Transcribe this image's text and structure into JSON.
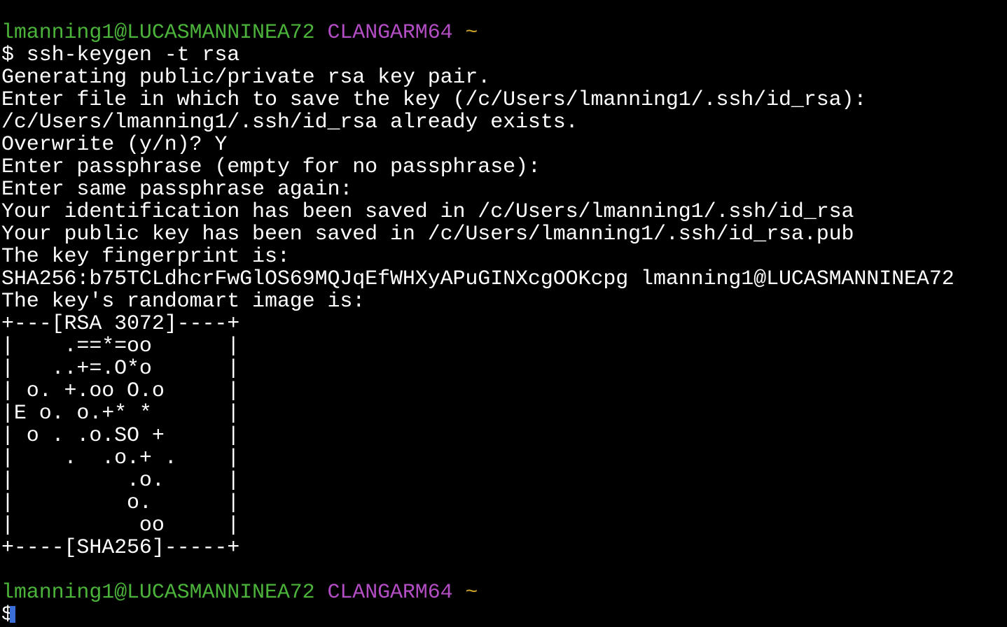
{
  "prompt_top": {
    "user": "lmanning1@LUCASMANNINEA72",
    "shell": "CLANGARM64",
    "dir": "~"
  },
  "command": "$ ssh-keygen -t rsa",
  "output": [
    "Generating public/private rsa key pair.",
    "Enter file in which to save the key (/c/Users/lmanning1/.ssh/id_rsa):",
    "/c/Users/lmanning1/.ssh/id_rsa already exists.",
    "Overwrite (y/n)? Y",
    "Enter passphrase (empty for no passphrase):",
    "Enter same passphrase again:",
    "Your identification has been saved in /c/Users/lmanning1/.ssh/id_rsa",
    "Your public key has been saved in /c/Users/lmanning1/.ssh/id_rsa.pub",
    "The key fingerprint is:",
    "SHA256:b75TCLdhcrFwGlOS69MQJqEfWHXyAPuGINXcgOOKcpg lmanning1@LUCASMANNINEA72",
    "The key's randomart image is:"
  ],
  "randomart": [
    "+---[RSA 3072]----+",
    "|    .==*=oo      |",
    "|   ..+=.O*o      |",
    "| o. +.oo O.o     |",
    "|E o. o.+* *      |",
    "| o . .o.SO +     |",
    "|    .  .o.+ .    |",
    "|         .o.     |",
    "|         o.      |",
    "|          oo     |",
    "+----[SHA256]-----+"
  ],
  "prompt_bottom": {
    "user": "lmanning1@LUCASMANNINEA72",
    "shell": "CLANGARM64",
    "dir": "~"
  },
  "input_prompt": "$"
}
